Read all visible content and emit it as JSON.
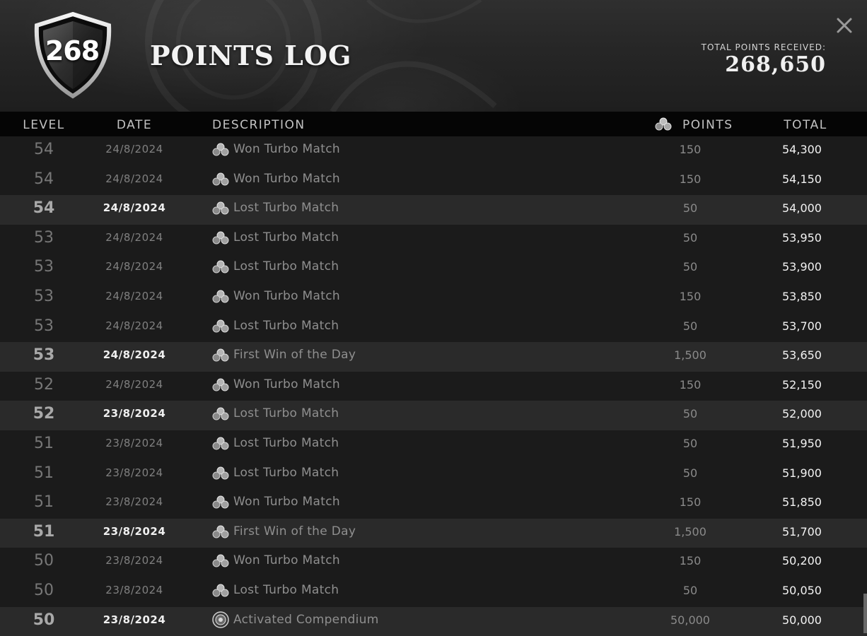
{
  "header": {
    "level_badge": "268",
    "title": "POINTS LOG",
    "total_label": "TOTAL POINTS RECEIVED:",
    "total_value": "268,650",
    "close_icon": "close-icon",
    "badge_icon": "shield-icon"
  },
  "columns": {
    "level": "LEVEL",
    "date": "DATE",
    "description": "DESCRIPTION",
    "points": "POINTS",
    "total": "TOTAL",
    "points_icon": "points-cluster-icon"
  },
  "rows": [
    {
      "level": "54",
      "date": "24/8/2024",
      "icon": "points-cluster-icon",
      "description": "Won Turbo Match",
      "points": "150",
      "total": "54,300",
      "highlight": false
    },
    {
      "level": "54",
      "date": "24/8/2024",
      "icon": "points-cluster-icon",
      "description": "Won Turbo Match",
      "points": "150",
      "total": "54,150",
      "highlight": false
    },
    {
      "level": "54",
      "date": "24/8/2024",
      "icon": "points-cluster-icon",
      "description": "Lost Turbo Match",
      "points": "50",
      "total": "54,000",
      "highlight": true
    },
    {
      "level": "53",
      "date": "24/8/2024",
      "icon": "points-cluster-icon",
      "description": "Lost Turbo Match",
      "points": "50",
      "total": "53,950",
      "highlight": false
    },
    {
      "level": "53",
      "date": "24/8/2024",
      "icon": "points-cluster-icon",
      "description": "Lost Turbo Match",
      "points": "50",
      "total": "53,900",
      "highlight": false
    },
    {
      "level": "53",
      "date": "24/8/2024",
      "icon": "points-cluster-icon",
      "description": "Won Turbo Match",
      "points": "150",
      "total": "53,850",
      "highlight": false
    },
    {
      "level": "53",
      "date": "24/8/2024",
      "icon": "points-cluster-icon",
      "description": "Lost Turbo Match",
      "points": "50",
      "total": "53,700",
      "highlight": false
    },
    {
      "level": "53",
      "date": "24/8/2024",
      "icon": "points-cluster-icon",
      "description": "First Win of the Day",
      "points": "1,500",
      "total": "53,650",
      "highlight": true
    },
    {
      "level": "52",
      "date": "24/8/2024",
      "icon": "points-cluster-icon",
      "description": "Won Turbo Match",
      "points": "150",
      "total": "52,150",
      "highlight": false
    },
    {
      "level": "52",
      "date": "23/8/2024",
      "icon": "points-cluster-icon",
      "description": "Lost Turbo Match",
      "points": "50",
      "total": "52,000",
      "highlight": true
    },
    {
      "level": "51",
      "date": "23/8/2024",
      "icon": "points-cluster-icon",
      "description": "Lost Turbo Match",
      "points": "50",
      "total": "51,950",
      "highlight": false
    },
    {
      "level": "51",
      "date": "23/8/2024",
      "icon": "points-cluster-icon",
      "description": "Lost Turbo Match",
      "points": "50",
      "total": "51,900",
      "highlight": false
    },
    {
      "level": "51",
      "date": "23/8/2024",
      "icon": "points-cluster-icon",
      "description": "Won Turbo Match",
      "points": "150",
      "total": "51,850",
      "highlight": false
    },
    {
      "level": "51",
      "date": "23/8/2024",
      "icon": "points-cluster-icon",
      "description": "First Win of the Day",
      "points": "1,500",
      "total": "51,700",
      "highlight": true
    },
    {
      "level": "50",
      "date": "23/8/2024",
      "icon": "points-cluster-icon",
      "description": "Won Turbo Match",
      "points": "150",
      "total": "50,200",
      "highlight": false
    },
    {
      "level": "50",
      "date": "23/8/2024",
      "icon": "points-cluster-icon",
      "description": "Lost Turbo Match",
      "points": "50",
      "total": "50,050",
      "highlight": false
    },
    {
      "level": "50",
      "date": "23/8/2024",
      "icon": "compendium-icon",
      "description": "Activated Compendium",
      "points": "50,000",
      "total": "50,000",
      "highlight": true
    }
  ],
  "colors": {
    "background": "#1b1b1b",
    "header_bar": "#050505",
    "row_highlight": "#2a2a2a",
    "text_bright": "#f2f2f2",
    "text_dim": "#8a8a8a"
  }
}
